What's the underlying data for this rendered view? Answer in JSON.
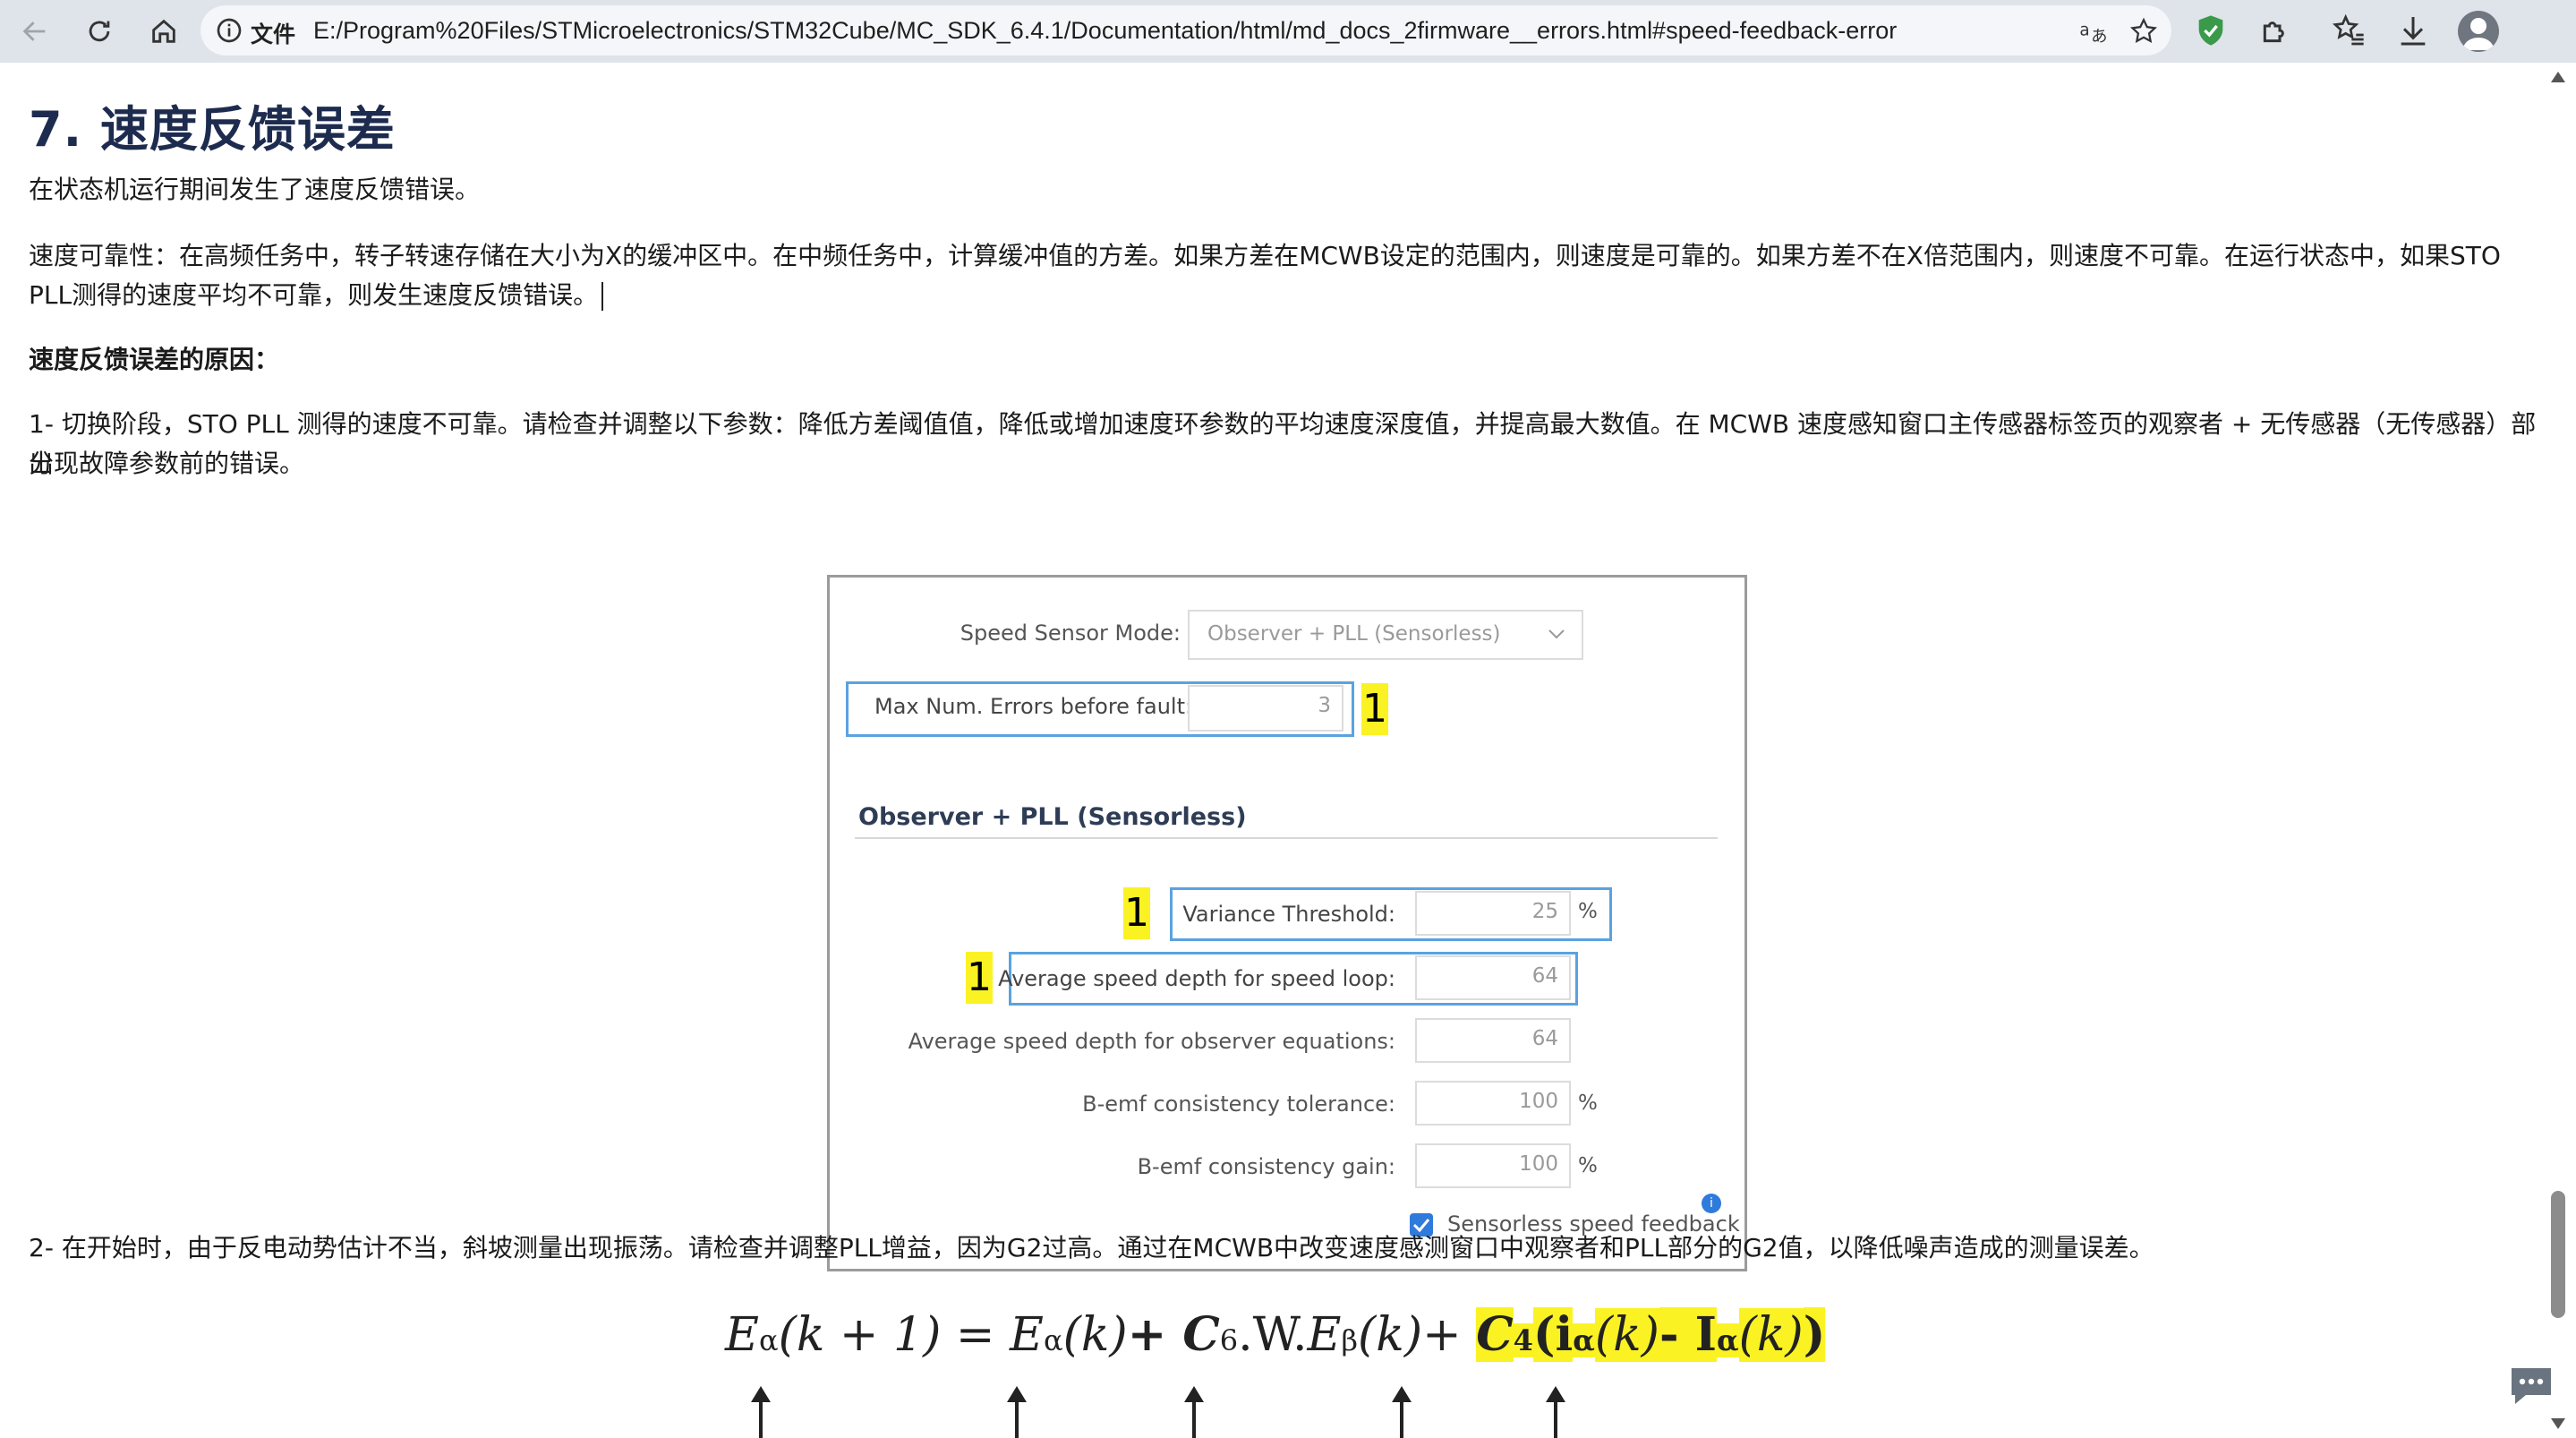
{
  "browser": {
    "protocol_label": "文件",
    "url": "E:/Program%20Files/STMicroelectronics/STM32Cube/MC_SDK_6.4.1/Documentation/html/md_docs_2firmware__errors.html#speed-feedback-error",
    "icons": [
      "back-icon",
      "reload-icon",
      "home-icon",
      "info-icon",
      "translate-icon",
      "star-icon",
      "shield-icon",
      "extensions-icon",
      "favorites-icon",
      "download-icon",
      "avatar"
    ]
  },
  "article": {
    "heading": "7. 速度反馈误差",
    "intro": "在状态机运行期间发生了速度反馈错误。",
    "reliability_line1": "速度可靠性：在高频任务中，转子转速存储在大小为X的缓冲区中。在中频任务中，计算缓冲值的方差。如果方差在MCWB设定的范围内，则速度是可靠的。如果方差不在X倍范围内，则速度不可靠。在运行状态中，如果STO",
    "reliability_line2": "PLL测得的速度平均不可靠，则发生速度反馈错误。",
    "causes_heading": "速度反馈误差的原因：",
    "cause1_line1": "1- 切换阶段，STO PLL 测得的速度不可靠。请检查并调整以下参数：降低方差阈值值，降低或增加速度环参数的平均速度深度值，并提高最大数值。在 MCWB 速度感知窗口主传感器标签页的观察者 + 无传感器（无传感器）部分",
    "cause1_line2": "出现故障参数前的错误。",
    "cause2": "2- 在开始时，由于反电动势估计不当，斜坡测量出现振荡。请检查并调整PLL增益，因为G2过高。通过在MCWB中改变速度感测窗口中观察者和PLL部分的G2值，以降低噪声造成的测量误差。"
  },
  "figure": {
    "speed_sensor_mode_label": "Speed Sensor Mode:",
    "speed_sensor_mode_value": "Observer + PLL (Sensorless)",
    "max_errors_label": "Max Num. Errors before fault:",
    "max_errors_value": "3",
    "section_title": "Observer + PLL (Sensorless)",
    "variance_label": "Variance Threshold:",
    "variance_value": "25",
    "avg_speed_loop_label": "Average speed depth for speed loop:",
    "avg_speed_loop_value": "64",
    "avg_observer_label": "Average speed depth for observer equations:",
    "avg_observer_value": "64",
    "bemf_tol_label": "B-emf consistency tolerance:",
    "bemf_tol_value": "100",
    "bemf_gain_label": "B-emf consistency gain:",
    "bemf_gain_value": "100",
    "percent": "%",
    "checkbox_label": "Sensorless speed feedback",
    "marker": "1",
    "info_glyph": "i"
  },
  "formula": {
    "E": "E",
    "alpha": "α",
    "beta": "β",
    "lhs_arg": "(k + 1)",
    "eq": " = ",
    "karg": "(k)",
    "plus": "+ ",
    "C6": "C",
    "six": "6",
    "W": ".W.",
    "C4": "C",
    "four": "4",
    "open": "(",
    "i": "i",
    "minus": "- I",
    "close": ")"
  }
}
